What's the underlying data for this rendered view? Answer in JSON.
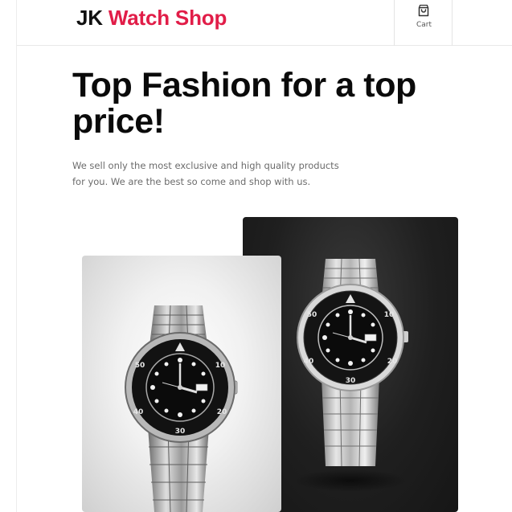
{
  "header": {
    "logo_brand": "JK",
    "logo_rest": "Watch Shop",
    "cart_label": "Cart",
    "cart_icon": "shopping-bag-icon",
    "accent_color": "#e11d48"
  },
  "hero": {
    "title": "Top Fashion for a top price!",
    "text": "We sell only the most exclusive and high quality products for you. We are the best so come and shop with us."
  },
  "products": {
    "image_left": "steel-dive-watch-light-background",
    "image_right": "steel-dive-watch-dark-background"
  }
}
